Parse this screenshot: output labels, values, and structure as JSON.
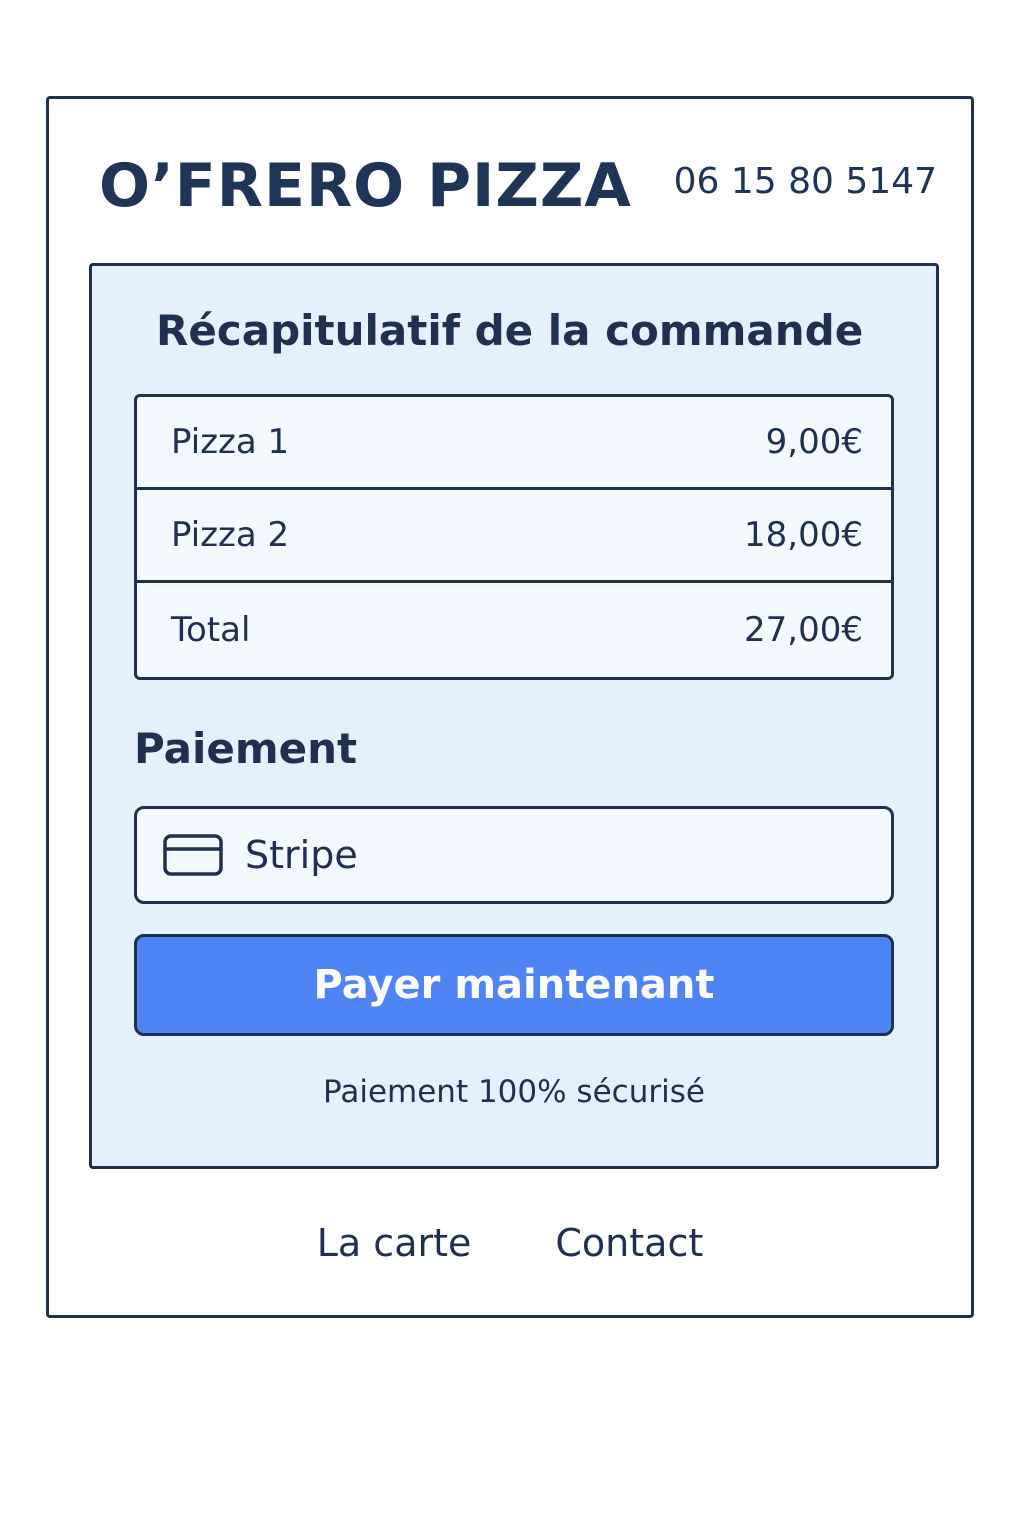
{
  "header": {
    "brand": "O’FRERO PIZZA",
    "phone": "06 15 80 5147"
  },
  "summary": {
    "title": "Récapitulatif de la commande",
    "items": [
      {
        "label": "Pizza 1",
        "price": "9,00€"
      },
      {
        "label": "Pizza 2",
        "price": "18,00€"
      },
      {
        "label": "Total",
        "price": "27,00€"
      }
    ]
  },
  "payment": {
    "title": "Paiement",
    "method_label": "Stripe",
    "method_icon": "credit-card-icon",
    "pay_button_label": "Payer maintenant",
    "secure_note": "Paiement 100% sécurisé"
  },
  "footer": {
    "links": [
      {
        "label": "La carte"
      },
      {
        "label": "Contact"
      }
    ]
  },
  "colors": {
    "ink": "#1f3050",
    "panel_bg": "#e4f0fc",
    "button_bg": "#4f84f5"
  }
}
